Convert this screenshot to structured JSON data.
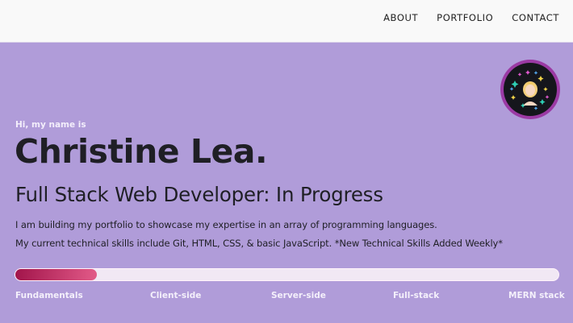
{
  "nav": {
    "about": "ABOUT",
    "portfolio": "PORTFOLIO",
    "contact": "CONTACT"
  },
  "hero": {
    "greeting": "Hi, my name is",
    "name": "Christine Lea.",
    "role": "Full Stack Web Developer: In Progress",
    "intro": "I am building my portfolio to showcase my expertise in an array of programming languages.",
    "skills": "My current technical skills include Git, HTML, CSS, & basic JavaScript. *New Technical Skills Added Weekly*"
  },
  "progress": {
    "value_fraction": 0.15,
    "stages": [
      "Fundamentals",
      "Client-side",
      "Server-side",
      "Full-stack",
      "MERN stack"
    ]
  },
  "avatar": {
    "icon": "profile-avatar-sparkles"
  },
  "colors": {
    "background": "#b09cd9",
    "progress_start": "#a2154b",
    "progress_end": "#e25a88",
    "avatar_ring": "#9b3aa4"
  }
}
